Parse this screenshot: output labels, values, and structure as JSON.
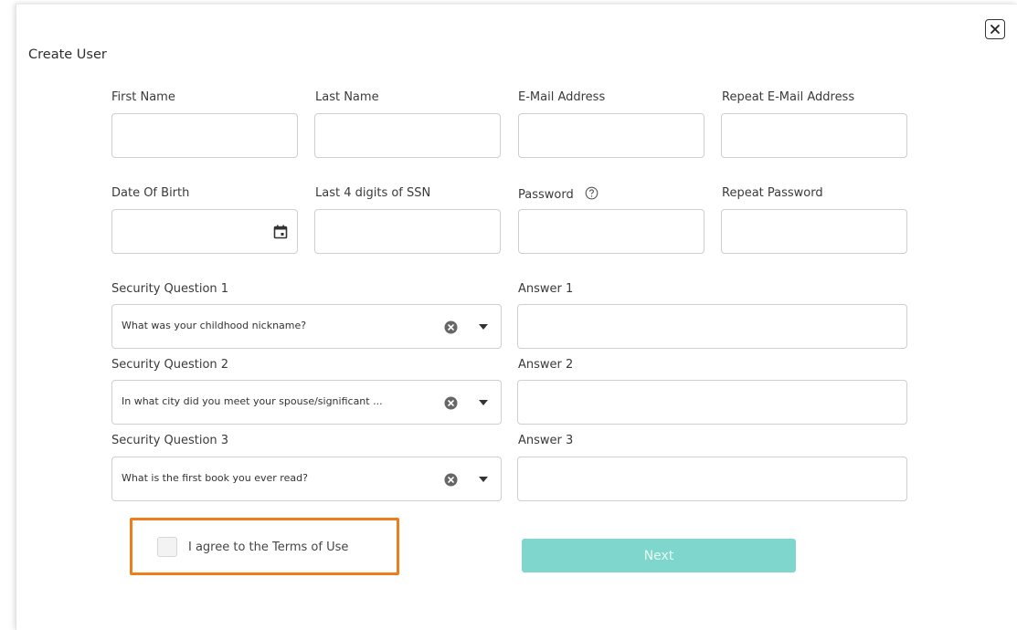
{
  "modal": {
    "title": "Create User",
    "close_icon": "close-icon"
  },
  "form": {
    "first_name": {
      "label": "First Name",
      "value": ""
    },
    "last_name": {
      "label": "Last Name",
      "value": ""
    },
    "email": {
      "label": "E-Mail Address",
      "value": ""
    },
    "repeat_email": {
      "label": "Repeat E-Mail Address",
      "value": ""
    },
    "dob": {
      "label": "Date Of Birth",
      "value": "",
      "icon": "calendar-icon"
    },
    "ssn": {
      "label": "Last 4 digits of SSN",
      "value": ""
    },
    "password": {
      "label": "Password",
      "value": "",
      "icon": "help-circle-icon"
    },
    "repeat_password": {
      "label": "Repeat Password",
      "value": ""
    },
    "security_questions": [
      {
        "label": "Security Question 1",
        "selected": "What was your childhood nickname?",
        "answer_label": "Answer 1",
        "answer_value": ""
      },
      {
        "label": "Security Question 2",
        "selected": "In what city did you meet your spouse/significant ...",
        "answer_label": "Answer 2",
        "answer_value": ""
      },
      {
        "label": "Security Question 3",
        "selected": "What is the first book you ever read?",
        "answer_label": "Answer 3",
        "answer_value": ""
      }
    ],
    "terms": {
      "label": "I agree to the Terms of Use",
      "checked": false,
      "highlight_color": "#ee7d1b"
    },
    "next_button": {
      "label": "Next",
      "enabled": false,
      "color": "#7fd6cc"
    }
  }
}
